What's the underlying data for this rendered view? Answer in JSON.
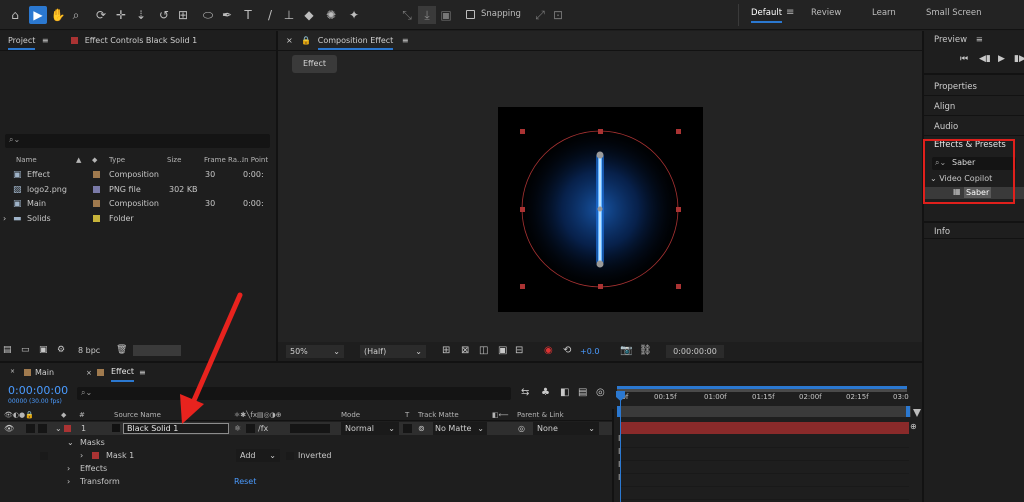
{
  "toolbar": {
    "tools": [
      "home-icon",
      "selection-icon",
      "hand-icon",
      "zoom-icon",
      "orbit-icon",
      "pan-icon",
      "dolly-icon",
      "rotate-icon",
      "pan-behind-icon",
      "ellipse-icon",
      "pen-icon",
      "type-icon",
      "brush-icon",
      "clone-stamp-icon",
      "eraser-icon",
      "roto-brush-icon",
      "puppet-pin-icon"
    ],
    "snapping_label": "Snapping",
    "workspaces": [
      "Default",
      "Review",
      "Learn",
      "Small Screen"
    ],
    "active_workspace": "Default"
  },
  "project_panel": {
    "tab_project": "Project",
    "tab_effect_controls": "Effect Controls Black Solid 1",
    "columns": {
      "name": "Name",
      "type": "Type",
      "size": "Size",
      "frame_rate": "Frame Ra...",
      "in_point": "In Point"
    },
    "items": [
      {
        "name": "Effect",
        "type": "Composition",
        "size": "",
        "fps": "30",
        "in": "0:00:",
        "color": "#a07a4e",
        "icon": "composition-icon"
      },
      {
        "name": "logo2.png",
        "type": "PNG file",
        "size": "302 KB",
        "fps": "",
        "in": "",
        "color": "#7a7aa8",
        "icon": "image-file-icon"
      },
      {
        "name": "Main",
        "type": "Composition",
        "size": "",
        "fps": "30",
        "in": "0:00:",
        "color": "#a07a4e",
        "icon": "composition-icon"
      },
      {
        "name": "Solids",
        "type": "Folder",
        "size": "",
        "fps": "",
        "in": "",
        "color": "#c8b43a",
        "icon": "folder-icon"
      }
    ],
    "bpc_label": "8 bpc"
  },
  "composition_panel": {
    "tab_label": "Composition Effect",
    "breadcrumb": "Effect",
    "zoom": "50%",
    "resolution": "(Half)",
    "exposure": "+0.0",
    "timecode": "0:00:00:00"
  },
  "right_panel": {
    "preview": "Preview",
    "properties": "Properties",
    "align": "Align",
    "audio": "Audio",
    "effects_presets": "Effects & Presets",
    "search_value": "Saber",
    "category": "Video Copilot",
    "effect_item": "Saber",
    "info": "Info",
    "highlight_color": "#e0201c"
  },
  "timeline": {
    "tab_main": "Main",
    "tab_effect": "Effect",
    "timecode": "0:00:00:00",
    "fps_note": "00000 (30.00 fps)",
    "headers": {
      "source_name": "Source Name",
      "mode": "Mode",
      "t": "T",
      "track_matte": "Track Matte",
      "parent_link": "Parent & Link"
    },
    "ruler": [
      "00f",
      "00:15f",
      "01:00f",
      "01:15f",
      "02:00f",
      "02:15f",
      "03:0"
    ],
    "layer": {
      "number": "1",
      "name": "Black Solid 1",
      "mode": "Normal",
      "matte": "No Matte",
      "parent": "None"
    },
    "properties": {
      "masks": "Masks",
      "mask1": "Mask 1",
      "mask_mode": "Add",
      "inverted": "Inverted",
      "effects": "Effects",
      "transform": "Transform",
      "reset": "Reset"
    },
    "bar_color": "#8a2a2a",
    "accent": "#2b78d0"
  },
  "annotation": {
    "arrow_color": "#e8231e"
  }
}
